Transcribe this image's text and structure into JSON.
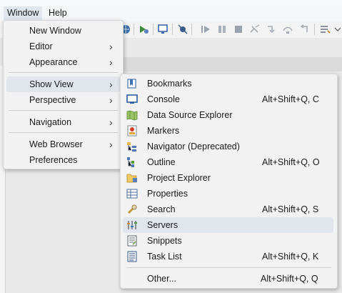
{
  "menubar": {
    "window": "Window",
    "help": "Help"
  },
  "window_menu": {
    "new_window": "New Window",
    "editor": "Editor",
    "appearance": "Appearance",
    "show_view": "Show View",
    "perspective": "Perspective",
    "navigation": "Navigation",
    "web_browser": "Web Browser",
    "preferences": "Preferences"
  },
  "show_view_menu": {
    "bookmarks": "Bookmarks",
    "console": "Console",
    "console_shortcut": "Alt+Shift+Q, C",
    "data_source_explorer": "Data Source Explorer",
    "markers": "Markers",
    "navigator": "Navigator (Deprecated)",
    "outline": "Outline",
    "outline_shortcut": "Alt+Shift+Q, O",
    "project_explorer": "Project Explorer",
    "properties": "Properties",
    "search": "Search",
    "search_shortcut": "Alt+Shift+Q, S",
    "servers": "Servers",
    "snippets": "Snippets",
    "task_list": "Task List",
    "task_list_shortcut": "Alt+Shift+Q, K",
    "other": "Other...",
    "other_shortcut": "Alt+Shift+Q, Q"
  },
  "submenu_arrow": "›"
}
